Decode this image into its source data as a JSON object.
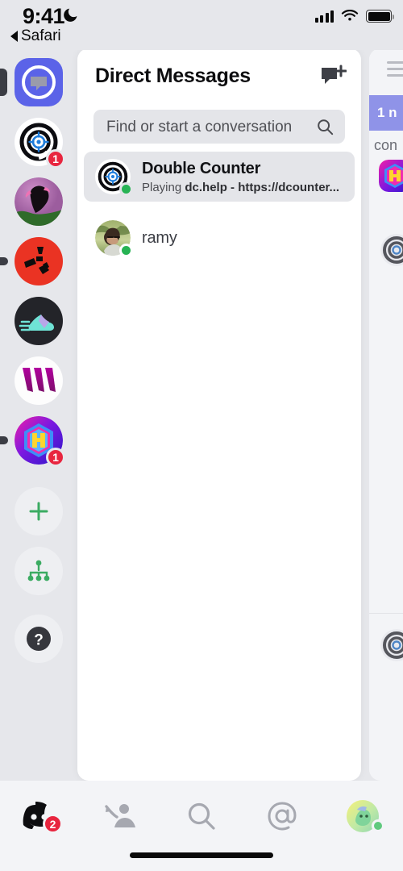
{
  "status_bar": {
    "time": "9:41",
    "dnd_icon": "moon-icon",
    "back_label": "Safari",
    "signal_icon": "cellular-signal-icon",
    "wifi_icon": "wifi-icon",
    "battery_icon": "battery-full-icon"
  },
  "server_rail": {
    "items": [
      {
        "name": "direct-messages-home",
        "label": "Direct Messages",
        "icon": "speech-bubble-icon",
        "badge": "",
        "active": true,
        "unread": false
      },
      {
        "name": "server-double-counter",
        "label": "Double Counter",
        "icon": "target-crosshair-icon",
        "badge": "1",
        "active": false,
        "unread": false
      },
      {
        "name": "server-anime-avatar",
        "label": "Server",
        "icon": "anime-avatar-icon",
        "badge": "",
        "active": false,
        "unread": false
      },
      {
        "name": "server-red",
        "label": "Server",
        "icon": "red-abstract-icon",
        "badge": "",
        "active": false,
        "unread": true
      },
      {
        "name": "server-sneaker",
        "label": "Server",
        "icon": "sneaker-icon",
        "badge": "",
        "active": false,
        "unread": false
      },
      {
        "name": "server-w",
        "label": "Server",
        "icon": "w-logo-icon",
        "badge": "",
        "active": false,
        "unread": false
      },
      {
        "name": "server-h-hex",
        "label": "Server",
        "icon": "h-hexagon-icon",
        "badge": "1",
        "active": false,
        "unread": true
      },
      {
        "name": "add-a-server",
        "label": "Add a Server",
        "icon": "plus-icon",
        "badge": "",
        "active": false,
        "unread": false
      },
      {
        "name": "explore-servers",
        "label": "Explore Public Servers",
        "icon": "compass-network-icon",
        "badge": "",
        "active": false,
        "unread": false
      },
      {
        "name": "help",
        "label": "Help",
        "icon": "question-mark-icon",
        "badge": "",
        "active": false,
        "unread": false
      }
    ]
  },
  "dm_panel": {
    "title": "Direct Messages",
    "new_dm_icon": "new-message-icon",
    "search": {
      "placeholder": "Find or start a conversation",
      "value": "",
      "icon": "search-icon"
    },
    "conversations": [
      {
        "name": "Double Counter",
        "status_prefix": "Playing",
        "status_activity": "dc.help - https://dcounter...",
        "presence": "online",
        "avatar": "target-crosshair-avatar",
        "selected": true
      },
      {
        "name": "ramy",
        "status_prefix": "",
        "status_activity": "",
        "presence": "online",
        "avatar": "photo-avatar",
        "selected": false
      }
    ]
  },
  "peek_panel": {
    "menu_icon": "hamburger-menu-icon",
    "banner_text": "1 n",
    "sub_text": "con",
    "visible": true
  },
  "tab_bar": {
    "tabs": [
      {
        "name": "tab-servers",
        "label": "Servers",
        "icon": "discord-logo-icon",
        "badge": "2",
        "active": true
      },
      {
        "name": "tab-friends",
        "label": "Friends",
        "icon": "person-wave-icon",
        "badge": "",
        "active": false
      },
      {
        "name": "tab-search",
        "label": "Search",
        "icon": "search-icon",
        "badge": "",
        "active": false
      },
      {
        "name": "tab-mentions",
        "label": "Mentions",
        "icon": "at-sign-icon",
        "badge": "",
        "active": false
      },
      {
        "name": "tab-profile",
        "label": "You",
        "icon": "user-avatar-icon",
        "badge": "",
        "active": false,
        "presence": "online"
      }
    ]
  },
  "colors": {
    "brand_blurple": "#5865f2",
    "online_green": "#27b354",
    "badge_red": "#e8253f",
    "app_background": "#e6e7eb",
    "panel_white": "#ffffff",
    "selected_row": "#e4e5e9",
    "banner_purple": "#8f93e8"
  }
}
